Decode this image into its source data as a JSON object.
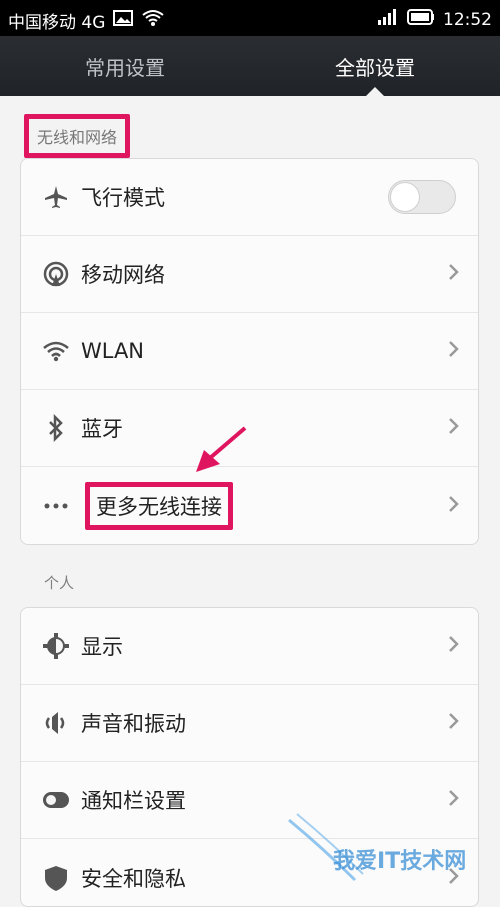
{
  "status_bar": {
    "carrier": "中国移动 4G",
    "time": "12:52"
  },
  "tabs": [
    {
      "label": "常用设置",
      "active": false
    },
    {
      "label": "全部设置",
      "active": true
    }
  ],
  "sections": {
    "wireless": {
      "title": "无线和网络",
      "items": [
        {
          "label": "飞行模式",
          "icon": "airplane-icon",
          "control": "toggle",
          "toggle_on": false
        },
        {
          "label": "移动网络",
          "icon": "mobile-network-icon",
          "control": "chevron"
        },
        {
          "label": "WLAN",
          "icon": "wifi-icon",
          "control": "chevron"
        },
        {
          "label": "蓝牙",
          "icon": "bluetooth-icon",
          "control": "chevron"
        },
        {
          "label": "更多无线连接",
          "icon": "more-dots-icon",
          "control": "chevron"
        }
      ]
    },
    "personal": {
      "title": "个人",
      "items": [
        {
          "label": "显示",
          "icon": "display-gear-icon",
          "control": "chevron"
        },
        {
          "label": "声音和振动",
          "icon": "sound-icon",
          "control": "chevron"
        },
        {
          "label": "通知栏设置",
          "icon": "notification-toggle-icon",
          "control": "chevron"
        },
        {
          "label": "安全和隐私",
          "icon": "shield-icon",
          "control": "chevron"
        }
      ]
    }
  },
  "colors": {
    "highlight": "#e0155f",
    "tab_bar": "#23262a"
  },
  "watermark": "我爱IT技术网"
}
